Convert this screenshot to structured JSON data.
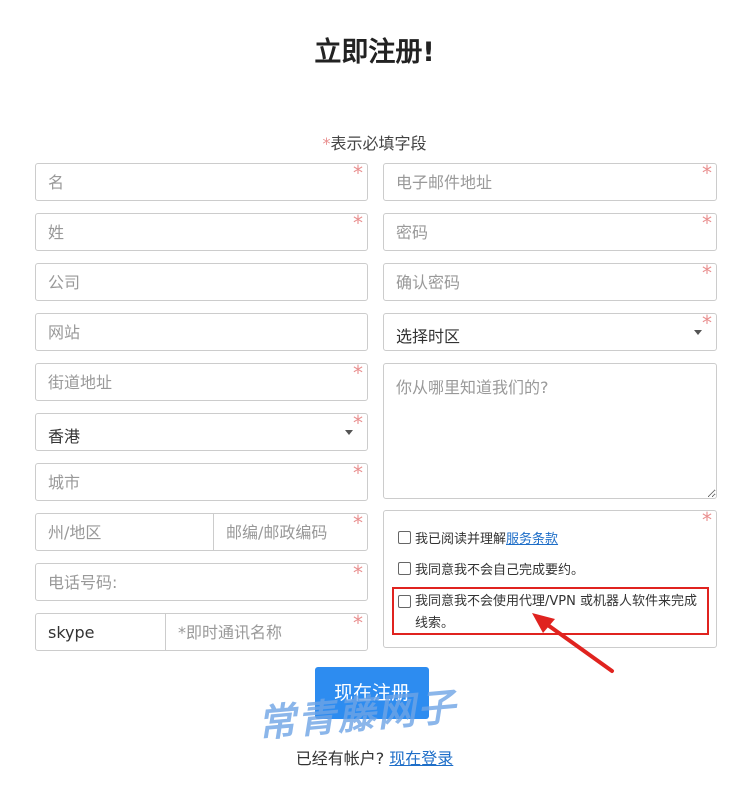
{
  "title": "立即注册!",
  "required_note": {
    "star": "*",
    "text": "表示必填字段"
  },
  "star": "*",
  "fields": {
    "first_name": "名",
    "email": "电子邮件地址",
    "last_name": "姓",
    "password": "密码",
    "company": "公司",
    "confirm_password": "确认密码",
    "website": "网站",
    "timezone": "选择时区",
    "street": "街道地址",
    "referral": "你从哪里知道我们的?",
    "country": "香港",
    "city": "城市",
    "state": "州/地区",
    "postcode": "邮编/邮政编码",
    "phone": "电话号码:",
    "im_type": "skype",
    "im_name": "*即时通讯名称"
  },
  "terms": {
    "agree_read_prefix": "我已阅读并理解",
    "agree_read_link": "服务条款",
    "agree_self": "我同意我不会自己完成要约。",
    "agree_no_vpn": "我同意我不会使用代理/VPN 或机器人软件来完成线索。"
  },
  "submit_label": "现在注册",
  "watermark": "常青藤网子",
  "login": {
    "prefix": "已经有帐户?",
    "link": "现在登录"
  },
  "colors": {
    "accent": "#2d8cf0",
    "required_star": "#e98f8f",
    "highlight": "#e0231f"
  }
}
